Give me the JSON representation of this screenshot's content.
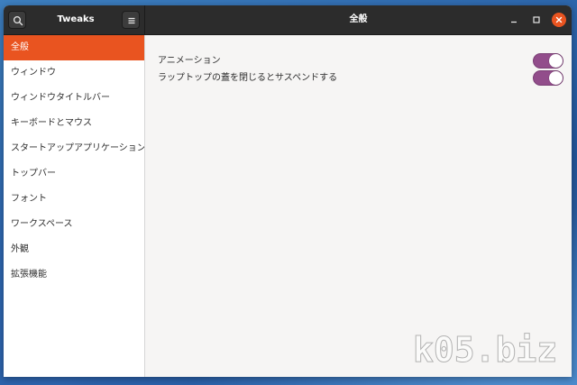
{
  "window": {
    "app_title": "Tweaks",
    "page_title": "全般"
  },
  "headerbar": {
    "search_icon": "search-icon",
    "menu_icon": "hamburger-menu-icon",
    "controls": [
      "minimize-icon",
      "maximize-icon",
      "close-icon"
    ]
  },
  "sidebar": {
    "items": [
      {
        "label": "全般",
        "selected": true
      },
      {
        "label": "ウィンドウ",
        "selected": false
      },
      {
        "label": "ウィンドウタイトルバー",
        "selected": false
      },
      {
        "label": "キーボードとマウス",
        "selected": false
      },
      {
        "label": "スタートアップアプリケーション",
        "selected": false
      },
      {
        "label": "トップバー",
        "selected": false
      },
      {
        "label": "フォント",
        "selected": false
      },
      {
        "label": "ワークスペース",
        "selected": false
      },
      {
        "label": "外観",
        "selected": false
      },
      {
        "label": "拡張機能",
        "selected": false
      }
    ]
  },
  "settings": [
    {
      "label": "アニメーション",
      "enabled": true
    },
    {
      "label": "ラップトップの蓋を閉じるとサスペンドする",
      "enabled": true
    }
  ],
  "colors": {
    "accent": "#e95420",
    "switch_on": "#924d8b",
    "headerbar": "#2c2c2c"
  },
  "watermark": "k05.biz"
}
